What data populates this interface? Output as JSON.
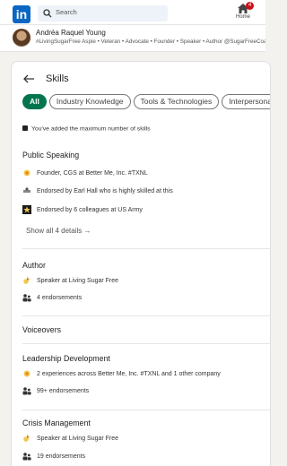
{
  "nav": {
    "logo": "in",
    "search_placeholder": "Search",
    "home_label": "Home",
    "home_badge": "4"
  },
  "profile": {
    "name": "Andréa Raquel Young",
    "tagline": "#LivingSugarFree Aspie • Veteran • Advocate • Founder • Speaker • Author @SugarFreeCoach"
  },
  "page": {
    "title": "Skills",
    "tabs": [
      "All",
      "Industry Knowledge",
      "Tools & Technologies",
      "Interpersonal"
    ],
    "notice": "You've added the maximum number of skills"
  },
  "skills": [
    {
      "name": "Public Speaking",
      "items": [
        "Founder, CGS at Better Me, Inc. #TXNL",
        "Endorsed by Earl Hall who is highly skilled at this",
        "Endorsed by 6 colleagues at US Army"
      ],
      "show_all": "Show all 4 details →"
    },
    {
      "name": "Author",
      "items": [
        "Speaker at Living Sugar Free",
        "4 endorsements"
      ]
    },
    {
      "name": "Voiceovers",
      "items": []
    },
    {
      "name": "Leadership Development",
      "items": [
        "2 experiences across Better Me, Inc. #TXNL and 1 other company",
        "99+ endorsements"
      ]
    },
    {
      "name": "Crisis Management",
      "items": [
        "Speaker at Living Sugar Free",
        "19 endorsements"
      ]
    }
  ],
  "colors": {
    "brand": "#0a66c2",
    "active_pill": "#01754f",
    "badge": "#cc1016"
  }
}
